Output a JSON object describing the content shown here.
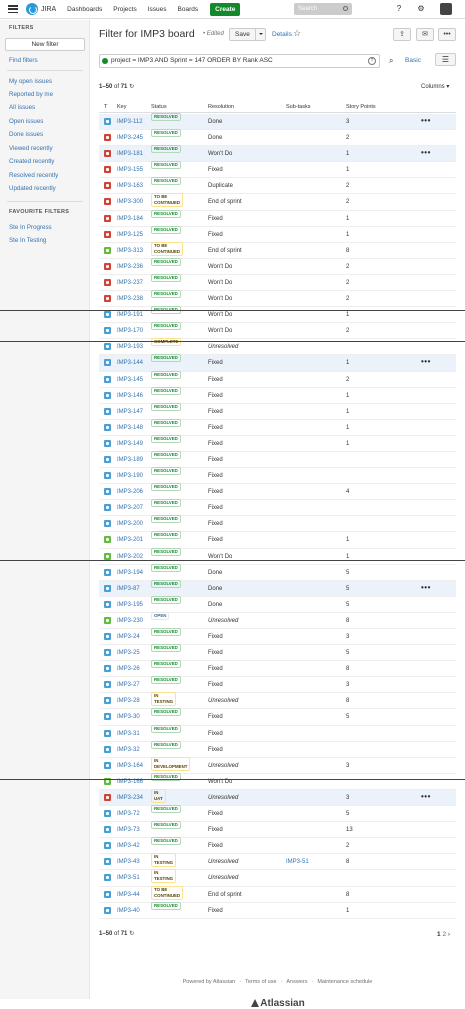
{
  "topbar": {
    "brand": "JIRA",
    "nav": [
      "Dashboards",
      "Projects",
      "Issues",
      "Boards"
    ],
    "create": "Create",
    "search_placeholder": "Search"
  },
  "sidebar": {
    "filters_header": "FILTERS",
    "new_filter": "New filter",
    "find_filters": "Find filters",
    "links": [
      "My open issues",
      "Reported by me",
      "All issues",
      "Open issues",
      "Done issues",
      "Viewed recently",
      "Created recently",
      "Resolved recently",
      "Updated recently"
    ],
    "fav_header": "FAVOURITE FILTERS",
    "favourites": [
      "Ste In Progress",
      "Ste In Testing"
    ]
  },
  "header": {
    "title": "Filter for IMP3 board",
    "edited": "• Edited",
    "save": "Save",
    "details": "Details"
  },
  "query": {
    "text": "project = IMP3 AND Sprint = 147 ORDER BY Rank ASC",
    "basic": "Basic"
  },
  "pagination": {
    "range": "1–50",
    "of": "of",
    "total": "71",
    "page_current": "1",
    "page_next": "2"
  },
  "columns_label": "Columns",
  "table": {
    "headers": [
      "T",
      "Key",
      "Status",
      "Resolution",
      "Sub-tasks",
      "Story Points"
    ],
    "rows": [
      {
        "type": "task",
        "key": "IMP3-112",
        "status": "RESOLVED",
        "resolution": "Done",
        "subtasks": "",
        "points": "3",
        "sel": true,
        "more": true
      },
      {
        "type": "bug",
        "key": "IMP3-245",
        "status": "RESOLVED",
        "resolution": "Done",
        "subtasks": "",
        "points": "2"
      },
      {
        "type": "bug",
        "key": "IMP3-181",
        "status": "RESOLVED",
        "resolution": "Won't Do",
        "subtasks": "",
        "points": "1",
        "sel": true,
        "more": true
      },
      {
        "type": "bug",
        "key": "IMP3-155",
        "status": "RESOLVED",
        "resolution": "Fixed",
        "subtasks": "",
        "points": "1"
      },
      {
        "type": "bug",
        "key": "IMP3-163",
        "status": "RESOLVED",
        "resolution": "Duplicate",
        "subtasks": "",
        "points": "2"
      },
      {
        "type": "bug",
        "key": "IMP3-300",
        "status": "TO BE CONTINUED",
        "resolution": "End of sprint",
        "subtasks": "",
        "points": "2"
      },
      {
        "type": "bug",
        "key": "IMP3-184",
        "status": "RESOLVED",
        "resolution": "Fixed",
        "subtasks": "",
        "points": "1"
      },
      {
        "type": "bug",
        "key": "IMP3-125",
        "status": "RESOLVED",
        "resolution": "Fixed",
        "subtasks": "",
        "points": "1"
      },
      {
        "type": "story",
        "key": "IMP3-313",
        "status": "TO BE CONTINUED",
        "resolution": "End of sprint",
        "subtasks": "",
        "points": "8"
      },
      {
        "type": "bug",
        "key": "IMP3-236",
        "status": "RESOLVED",
        "resolution": "Won't Do",
        "subtasks": "",
        "points": "2"
      },
      {
        "type": "bug",
        "key": "IMP3-237",
        "status": "RESOLVED",
        "resolution": "Won't Do",
        "subtasks": "",
        "points": "2"
      },
      {
        "type": "bug",
        "key": "IMP3-238",
        "status": "RESOLVED",
        "resolution": "Won't Do",
        "subtasks": "",
        "points": "2"
      },
      {
        "type": "task",
        "key": "IMP3-191",
        "status": "RESOLVED",
        "resolution": "Won't Do",
        "subtasks": "",
        "points": "1"
      },
      {
        "type": "task",
        "key": "IMP3-170",
        "status": "RESOLVED",
        "resolution": "Won't Do",
        "subtasks": "",
        "points": "2"
      },
      {
        "type": "task",
        "key": "IMP3-193",
        "status": "COMPLETE",
        "resolution": "Unresolved",
        "subtasks": "",
        "points": ""
      },
      {
        "type": "task",
        "key": "IMP3-144",
        "status": "RESOLVED",
        "resolution": "Fixed",
        "subtasks": "",
        "points": "1",
        "sel": true,
        "more": true
      },
      {
        "type": "task",
        "key": "IMP3-145",
        "status": "RESOLVED",
        "resolution": "Fixed",
        "subtasks": "",
        "points": "2"
      },
      {
        "type": "task",
        "key": "IMP3-146",
        "status": "RESOLVED",
        "resolution": "Fixed",
        "subtasks": "",
        "points": "1"
      },
      {
        "type": "task",
        "key": "IMP3-147",
        "status": "RESOLVED",
        "resolution": "Fixed",
        "subtasks": "",
        "points": "1"
      },
      {
        "type": "task",
        "key": "IMP3-148",
        "status": "RESOLVED",
        "resolution": "Fixed",
        "subtasks": "",
        "points": "1"
      },
      {
        "type": "task",
        "key": "IMP3-149",
        "status": "RESOLVED",
        "resolution": "Fixed",
        "subtasks": "",
        "points": "1"
      },
      {
        "type": "task",
        "key": "IMP3-189",
        "status": "RESOLVED",
        "resolution": "Fixed",
        "subtasks": "",
        "points": ""
      },
      {
        "type": "task",
        "key": "IMP3-190",
        "status": "RESOLVED",
        "resolution": "Fixed",
        "subtasks": "",
        "points": ""
      },
      {
        "type": "task",
        "key": "IMP3-206",
        "status": "RESOLVED",
        "resolution": "Fixed",
        "subtasks": "",
        "points": "4"
      },
      {
        "type": "task",
        "key": "IMP3-207",
        "status": "RESOLVED",
        "resolution": "Fixed",
        "subtasks": "",
        "points": ""
      },
      {
        "type": "task",
        "key": "IMP3-200",
        "status": "RESOLVED",
        "resolution": "Fixed",
        "subtasks": "",
        "points": ""
      },
      {
        "type": "story",
        "key": "IMP3-201",
        "status": "RESOLVED",
        "resolution": "Fixed",
        "subtasks": "",
        "points": "1"
      },
      {
        "type": "story",
        "key": "IMP3-202",
        "status": "RESOLVED",
        "resolution": "Won't Do",
        "subtasks": "",
        "points": "1"
      },
      {
        "type": "task",
        "key": "IMP3-194",
        "status": "RESOLVED",
        "resolution": "Done",
        "subtasks": "",
        "points": "5"
      },
      {
        "type": "task",
        "key": "IMP3-87",
        "status": "RESOLVED",
        "resolution": "Done",
        "subtasks": "",
        "points": "5",
        "sel": true,
        "more": true
      },
      {
        "type": "task",
        "key": "IMP3-195",
        "status": "RESOLVED",
        "resolution": "Done",
        "subtasks": "",
        "points": "5"
      },
      {
        "type": "story",
        "key": "IMP3-230",
        "status": "OPEN",
        "resolution": "Unresolved",
        "subtasks": "",
        "points": "8"
      },
      {
        "type": "task",
        "key": "IMP3-24",
        "status": "RESOLVED",
        "resolution": "Fixed",
        "subtasks": "",
        "points": "3"
      },
      {
        "type": "task",
        "key": "IMP3-25",
        "status": "RESOLVED",
        "resolution": "Fixed",
        "subtasks": "",
        "points": "5"
      },
      {
        "type": "task",
        "key": "IMP3-26",
        "status": "RESOLVED",
        "resolution": "Fixed",
        "subtasks": "",
        "points": "8"
      },
      {
        "type": "task",
        "key": "IMP3-27",
        "status": "RESOLVED",
        "resolution": "Fixed",
        "subtasks": "",
        "points": "3"
      },
      {
        "type": "task",
        "key": "IMP3-28",
        "status": "IN TESTING",
        "resolution": "Unresolved",
        "subtasks": "",
        "points": "8"
      },
      {
        "type": "task",
        "key": "IMP3-30",
        "status": "RESOLVED",
        "resolution": "Fixed",
        "subtasks": "",
        "points": "5"
      },
      {
        "type": "task",
        "key": "IMP3-31",
        "status": "RESOLVED",
        "resolution": "Fixed",
        "subtasks": "",
        "points": ""
      },
      {
        "type": "task",
        "key": "IMP3-32",
        "status": "RESOLVED",
        "resolution": "Fixed",
        "subtasks": "",
        "points": ""
      },
      {
        "type": "task",
        "key": "IMP3-164",
        "status": "IN DEVELOPMENT",
        "resolution": "Unresolved",
        "subtasks": "",
        "points": "3"
      },
      {
        "type": "story",
        "key": "IMP3-166",
        "status": "RESOLVED",
        "resolution": "Won't Do",
        "subtasks": "",
        "points": ""
      },
      {
        "type": "bug",
        "key": "IMP3-234",
        "status": "IN UAT",
        "resolution": "Unresolved",
        "subtasks": "",
        "points": "3",
        "sel": true,
        "more": true
      },
      {
        "type": "task",
        "key": "IMP3-72",
        "status": "RESOLVED",
        "resolution": "Fixed",
        "subtasks": "",
        "points": "5"
      },
      {
        "type": "task",
        "key": "IMP3-73",
        "status": "RESOLVED",
        "resolution": "Fixed",
        "subtasks": "",
        "points": "13"
      },
      {
        "type": "task",
        "key": "IMP3-42",
        "status": "RESOLVED",
        "resolution": "Fixed",
        "subtasks": "",
        "points": "2"
      },
      {
        "type": "task",
        "key": "IMP3-43",
        "status": "IN TESTING",
        "resolution": "Unresolved",
        "subtasks": "IMP3-51",
        "points": "8"
      },
      {
        "type": "task",
        "key": "IMP3-51",
        "status": "IN TESTING",
        "resolution": "Unresolved",
        "subtasks": "",
        "points": ""
      },
      {
        "type": "task",
        "key": "IMP3-44",
        "status": "TO BE CONTINUED",
        "resolution": "End of sprint",
        "subtasks": "",
        "points": "8"
      },
      {
        "type": "task",
        "key": "IMP3-40",
        "status": "RESOLVED",
        "resolution": "Fixed",
        "subtasks": "",
        "points": "1"
      }
    ]
  },
  "footer": {
    "links": [
      "Powered by Atlassian",
      "Terms of use",
      "Answers",
      "Maintenance schedule"
    ],
    "logo": "Atlassian"
  },
  "colors": {
    "link": "#3572b0",
    "create": "#14892c",
    "resolved": "#14892c",
    "bug": "#d04437",
    "story": "#63ba3c",
    "task": "#4a9fd6"
  }
}
